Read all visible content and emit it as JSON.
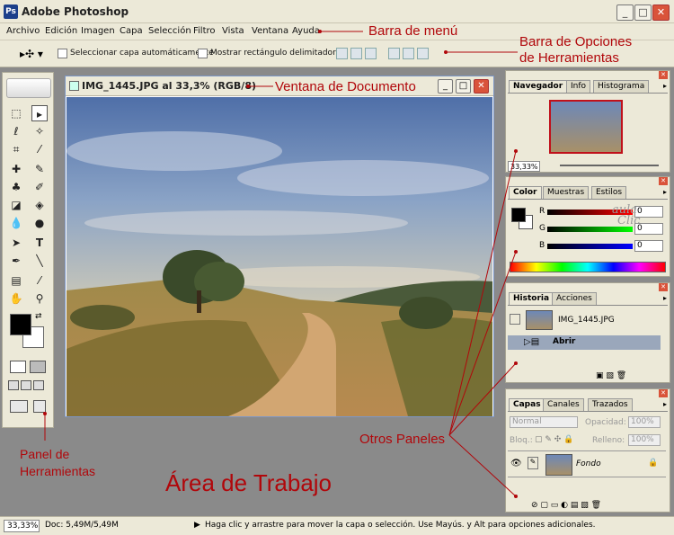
{
  "window": {
    "title": "Adobe Photoshop",
    "app_icon": "Ps"
  },
  "menu": [
    "Archivo",
    "Edición",
    "Imagen",
    "Capa",
    "Selección",
    "Filtro",
    "Vista",
    "Ventana",
    "Ayuda"
  ],
  "options": {
    "auto_select_layer": "Seleccionar capa automáticamente",
    "show_bounding_box": "Mostrar rectángulo delimitador"
  },
  "document": {
    "title": "IMG_1445.JPG al 33,3% (RGB/8)"
  },
  "navigator": {
    "tabs": [
      "Navegador",
      "Info",
      "Histograma"
    ],
    "zoom": "33,33%"
  },
  "color": {
    "tabs": [
      "Color",
      "Muestras",
      "Estilos"
    ],
    "channels": [
      {
        "label": "R",
        "value": "0"
      },
      {
        "label": "G",
        "value": "0"
      },
      {
        "label": "B",
        "value": "0"
      }
    ],
    "watermark_line1": "aula",
    "watermark_line2": "Clic"
  },
  "history": {
    "tabs": [
      "Historia",
      "Acciones"
    ],
    "snapshot": "IMG_1445.JPG",
    "state": "Abrir"
  },
  "layers": {
    "tabs": [
      "Capas",
      "Canales",
      "Trazados"
    ],
    "blend_mode": "Normal",
    "opacity_label": "Opacidad:",
    "opacity": "100%",
    "lock_label": "Bloq.:",
    "fill_label": "Relleno:",
    "fill": "100%",
    "layer_name": "Fondo"
  },
  "status": {
    "zoom": "33,33%",
    "doc": "Doc: 5,49M/5,49M",
    "hint": "Haga clic y arrastre para mover la capa o selección. Use Mayús. y Alt para opciones adicionales."
  },
  "annotations": {
    "menu_bar": "Barra de menú",
    "options_bar_1": "Barra de Opciones",
    "options_bar_2": "de Herramientas",
    "doc_window": "Ventana de Documento",
    "tools_1": "Panel de",
    "tools_2": "Herramientas",
    "work_area": "Área de Trabajo",
    "other_panels": "Otros Paneles"
  },
  "colors": {
    "annotation": "#b1070b",
    "chrome": "#ece9d8",
    "workspace": "#8a8a8a"
  }
}
